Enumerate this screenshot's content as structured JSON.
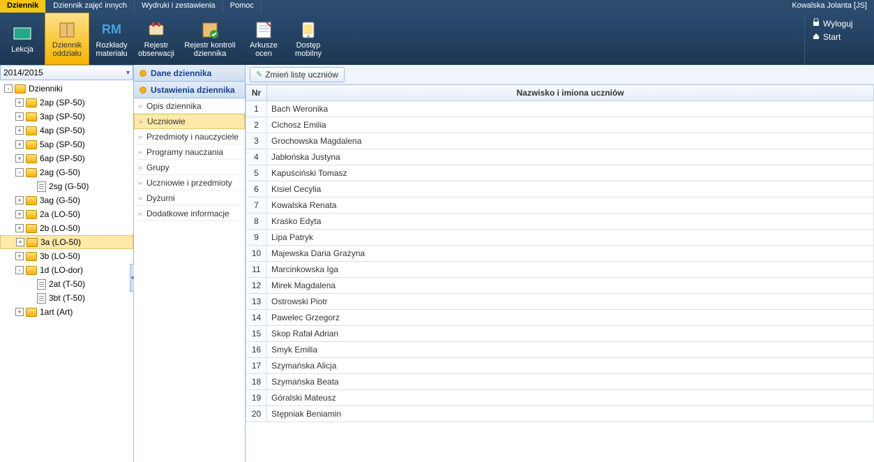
{
  "menubar": {
    "items": [
      {
        "label": "Dziennik",
        "active": true
      },
      {
        "label": "Dziennik zajęć innych"
      },
      {
        "label": "Wydruki i zestawienia"
      },
      {
        "label": "Pomoc"
      }
    ],
    "userLabel": "Kowalska Jolanta [JS]"
  },
  "ribbon": {
    "buttons": [
      {
        "label": "Lekcja",
        "icon": "board"
      },
      {
        "label": "Dziennik oddziału",
        "icon": "book",
        "active": true
      },
      {
        "label": "Rozkłady materiału",
        "icon": "rm"
      },
      {
        "label": "Rejestr obserwacji",
        "icon": "register"
      },
      {
        "label": "Rejestr kontroli dziennika",
        "icon": "check",
        "wide": true
      },
      {
        "label": "Arkusze ocen",
        "icon": "sheet"
      },
      {
        "label": "Dostęp mobilny",
        "icon": "mobile"
      }
    ],
    "links": [
      {
        "label": "Wyloguj",
        "icon": "lock"
      },
      {
        "label": "Start",
        "icon": "home"
      }
    ]
  },
  "yearSelect": "2014/2015",
  "tree": [
    {
      "label": "Dzienniki",
      "lvl": 1,
      "exp": "-",
      "icon": "folder"
    },
    {
      "label": "2ap (SP-50)",
      "lvl": 2,
      "exp": "+",
      "icon": "folder"
    },
    {
      "label": "3ap (SP-50)",
      "lvl": 2,
      "exp": "+",
      "icon": "folder"
    },
    {
      "label": "4ap (SP-50)",
      "lvl": 2,
      "exp": "+",
      "icon": "folder"
    },
    {
      "label": "5ap (SP-50)",
      "lvl": 2,
      "exp": "+",
      "icon": "folder"
    },
    {
      "label": "6ap (SP-50)",
      "lvl": 2,
      "exp": "+",
      "icon": "folder"
    },
    {
      "label": "2ag (G-50)",
      "lvl": 2,
      "exp": "-",
      "icon": "folder"
    },
    {
      "label": "2sg (G-50)",
      "lvl": 3,
      "exp": "",
      "icon": "file"
    },
    {
      "label": "3ag (G-50)",
      "lvl": 2,
      "exp": "+",
      "icon": "folder"
    },
    {
      "label": "2a (LO-50)",
      "lvl": 2,
      "exp": "+",
      "icon": "folder"
    },
    {
      "label": "2b (LO-50)",
      "lvl": 2,
      "exp": "+",
      "icon": "folder"
    },
    {
      "label": "3a (LO-50)",
      "lvl": 2,
      "exp": "+",
      "icon": "folder",
      "selected": true
    },
    {
      "label": "3b (LO-50)",
      "lvl": 2,
      "exp": "+",
      "icon": "folder"
    },
    {
      "label": "1d (LO-dor)",
      "lvl": 2,
      "exp": "-",
      "icon": "folder"
    },
    {
      "label": "2at (T-50)",
      "lvl": 3,
      "exp": "",
      "icon": "file"
    },
    {
      "label": "3bt (T-50)",
      "lvl": 3,
      "exp": "",
      "icon": "file"
    },
    {
      "label": "1art (Art)",
      "lvl": 2,
      "exp": "+",
      "icon": "folder"
    }
  ],
  "midpanel": {
    "header1": "Dane dziennika",
    "header2": "Ustawienia dziennika",
    "items": [
      {
        "label": "Opis dziennika"
      },
      {
        "label": "Uczniowie",
        "selected": true
      },
      {
        "label": "Przedmioty i nauczyciele"
      },
      {
        "label": "Programy nauczania"
      },
      {
        "label": "Grupy"
      },
      {
        "label": "Uczniowie i przedmioty"
      },
      {
        "label": "Dyżurni"
      },
      {
        "label": "Dodatkowe informacje"
      }
    ]
  },
  "toolbar": {
    "editButton": "Zmień listę uczniów"
  },
  "table": {
    "headers": {
      "nr": "Nr",
      "name": "Nazwisko i imiona uczniów"
    },
    "rows": [
      {
        "nr": "1",
        "name": "Bach Weronika"
      },
      {
        "nr": "2",
        "name": "Cichosz Emilia"
      },
      {
        "nr": "3",
        "name": "Grochowska Magdalena"
      },
      {
        "nr": "4",
        "name": "Jabłońska Justyna"
      },
      {
        "nr": "5",
        "name": "Kapuściński Tomasz"
      },
      {
        "nr": "6",
        "name": "Kisiel Cecylia"
      },
      {
        "nr": "7",
        "name": "Kowalska Renata"
      },
      {
        "nr": "8",
        "name": "Kraśko Edyta"
      },
      {
        "nr": "9",
        "name": "Lipa Patryk"
      },
      {
        "nr": "10",
        "name": "Majewska Daria Grażyna"
      },
      {
        "nr": "11",
        "name": "Marcinkowska Iga"
      },
      {
        "nr": "12",
        "name": "Mirek Magdalena"
      },
      {
        "nr": "13",
        "name": "Ostrowski Piotr"
      },
      {
        "nr": "14",
        "name": "Pawelec Grzegorz"
      },
      {
        "nr": "15",
        "name": "Skop Rafał Adrian"
      },
      {
        "nr": "16",
        "name": "Smyk Emilia"
      },
      {
        "nr": "17",
        "name": "Szymańska Alicja"
      },
      {
        "nr": "18",
        "name": "Szymańska Beata"
      },
      {
        "nr": "19",
        "name": "Góralski Mateusz"
      },
      {
        "nr": "20",
        "name": "Stępniak Beniamin"
      }
    ]
  }
}
